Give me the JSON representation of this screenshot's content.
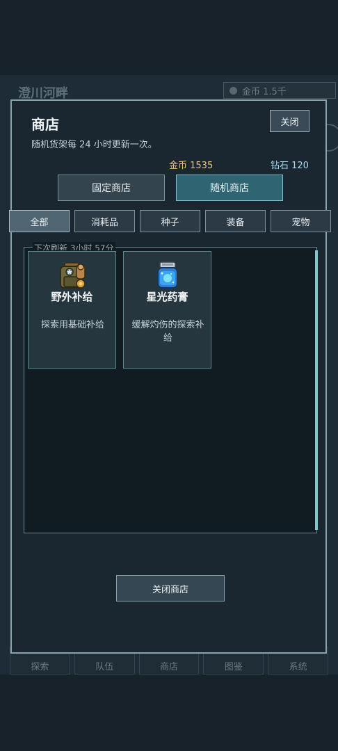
{
  "background": {
    "location": "澄川河畔",
    "gold_status": "金币 1.5千",
    "nav": [
      "探索",
      "队伍",
      "商店",
      "图鉴",
      "系统"
    ]
  },
  "modal": {
    "title": "商店",
    "subtitle": "随机货架每 24 小时更新一次。",
    "close_label": "关闭",
    "gold": "金币 1535",
    "diamonds": "钻石 120",
    "shop_tabs": [
      "固定商店",
      "随机商店"
    ],
    "active_shop_tab": "随机商店",
    "categories": [
      "全部",
      "消耗品",
      "种子",
      "装备",
      "宠物"
    ],
    "active_category": "全部",
    "refresh_text": "下次刷新 3小时 57分",
    "items": [
      {
        "name": "野外补给",
        "desc": "探索用基础补给",
        "icon": "backpack-icon"
      },
      {
        "name": "星光药膏",
        "desc": "缓解灼伤的探索补给",
        "icon": "potion-jar-icon"
      }
    ],
    "close_shop_label": "关闭商店"
  },
  "colors": {
    "accent_active_tab": "#2f6473",
    "gold_text": "#e8c97a",
    "diamond_text": "#a9dcf0",
    "card_border": "#5a8d8b"
  }
}
